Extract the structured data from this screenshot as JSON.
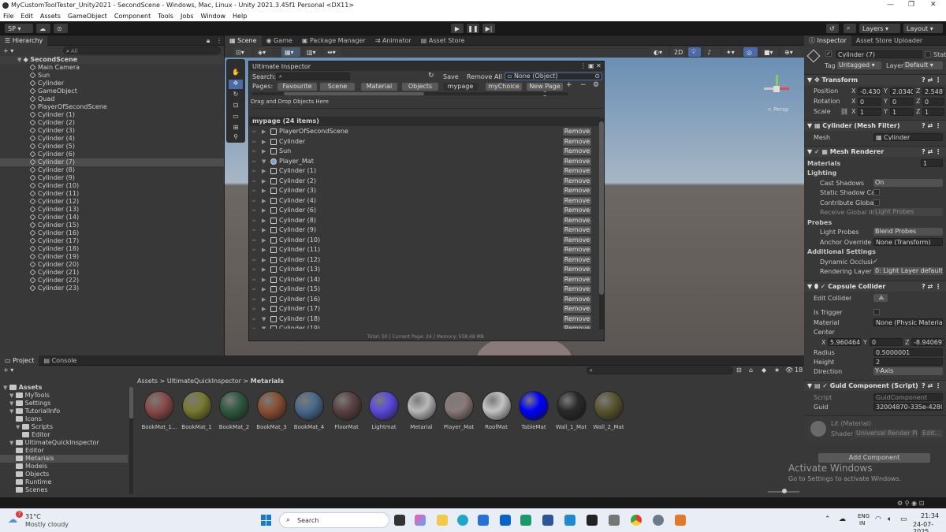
{
  "window": {
    "title": "MyCustomToolTester_Unity2021 - SecondScene - Windows, Mac, Linux - Unity 2021.3.45f1 Personal <DX11>",
    "controls": [
      "—",
      "❐",
      "✕"
    ]
  },
  "menu": [
    "File",
    "Edit",
    "Assets",
    "GameObject",
    "Component",
    "Tools",
    "Jobs",
    "Window",
    "Help"
  ],
  "toolbar": {
    "account": "SP ▾",
    "layers": "Layers",
    "layout": "Layout"
  },
  "hierarchy": {
    "tab": "Hierarchy",
    "search_placeholder": "All",
    "scene": "SecondScene",
    "items": [
      "Main Camera",
      "Sun",
      "Cylinder",
      "GameObject",
      "Quad",
      "PlayerOfSecondScene",
      "Cylinder (1)",
      "Cylinder (2)",
      "Cylinder (3)",
      "Cylinder (4)",
      "Cylinder (5)",
      "Cylinder (6)",
      "Cylinder (7)",
      "Cylinder (8)",
      "Cylinder (9)",
      "Cylinder (10)",
      "Cylinder (11)",
      "Cylinder (12)",
      "Cylinder (13)",
      "Cylinder (14)",
      "Cylinder (15)",
      "Cylinder (16)",
      "Cylinder (17)",
      "Cylinder (18)",
      "Cylinder (19)",
      "Cylinder (20)",
      "Cylinder (21)",
      "Cylinder (22)",
      "Cylinder (23)"
    ],
    "selected": "Cylinder (7)"
  },
  "center_tabs": [
    "Scene",
    "Game",
    "Package Manager",
    "Animator",
    "Asset Store"
  ],
  "scene_view": {
    "mode_2d": "2D",
    "persp": "< Persp"
  },
  "ultimate_inspector": {
    "title": "Ultimate Inspector",
    "search_label": "Search:",
    "save": "Save",
    "remove_all": "Remove All",
    "object_field": "None (Object)",
    "pages_label": "Pages:",
    "pages": [
      "Favourite",
      "Scene",
      "Material",
      "Objects",
      "mypage",
      "myChoice",
      "New Page 6"
    ],
    "active_page": "mypage",
    "drag_hint": "Drag and Drop Objects Here",
    "list_title": "mypage (24 items)",
    "remove_label": "Remove",
    "items": [
      "PlayerOfSecondScene",
      "Cylinder",
      "Sun",
      "Player_Mat",
      "Cylinder (1)",
      "Cylinder (2)",
      "Cylinder (3)",
      "Cylinder (4)",
      "Cylinder (6)",
      "Cylinder (8)",
      "Cylinder (9)",
      "Cylinder (10)",
      "Cylinder (11)",
      "Cylinder (12)",
      "Cylinder (13)",
      "Cylinder (14)",
      "Cylinder (15)",
      "Cylinder (16)",
      "Cylinder (17)",
      "Cylinder (18)",
      "Cylinder (19)"
    ],
    "footer": "Total: 50 | Current Page: 24 | Memory: 558.48 MB"
  },
  "inspector": {
    "tabs": [
      "Inspector",
      "Asset Store Uploader"
    ],
    "object_name": "Cylinder (7)",
    "static_label": "Static",
    "tag_label": "Tag",
    "tag_value": "Untagged",
    "layer_label": "Layer",
    "layer_value": "Default",
    "transform": {
      "title": "Transform",
      "position_label": "Position",
      "position": [
        "-0.430",
        "2.0340",
        "2.5487"
      ],
      "rotation_label": "Rotation",
      "rotation": [
        "0",
        "0",
        "0"
      ],
      "scale_label": "Scale",
      "scale": [
        "1",
        "1",
        "1"
      ]
    },
    "mesh_filter": {
      "title": "Cylinder (Mesh Filter)",
      "mesh_label": "Mesh",
      "mesh_value": "Cylinder"
    },
    "mesh_renderer": {
      "title": "Mesh Renderer",
      "materials_label": "Materials",
      "materials_count": "1",
      "lighting_label": "Lighting",
      "cast_shadows_label": "Cast Shadows",
      "cast_shadows": "On",
      "static_shadow_label": "Static Shadow Cas",
      "contribute_gi_label": "Contribute Global I",
      "receive_gi_label": "Receive Global Illu",
      "receive_gi": "Light Probes",
      "probes_label": "Probes",
      "light_probes_label": "Light Probes",
      "light_probes": "Blend Probes",
      "anchor_label": "Anchor Override",
      "anchor": "None (Transform)",
      "additional_label": "Additional Settings",
      "dynamic_occ_label": "Dynamic Occlusio",
      "rendering_layer_label": "Rendering Layer M",
      "rendering_layer": "0: Light Layer default"
    },
    "capsule": {
      "title": "Capsule Collider",
      "edit_label": "Edit Collider",
      "trigger_label": "Is Trigger",
      "material_label": "Material",
      "material": "None (Physic Materia",
      "center_label": "Center",
      "center": [
        "5.960464e",
        "0",
        "-8.940697"
      ],
      "radius_label": "Radius",
      "radius": "0.5000001",
      "height_label": "Height",
      "height": "2",
      "direction_label": "Direction",
      "direction": "Y-Axis"
    },
    "guid": {
      "title": "Guid Component (Script)",
      "script_label": "Script",
      "script": "GuidComponent",
      "guid_label": "Guid",
      "guid": "32004870-335e-4280-"
    },
    "material_preview": {
      "name": "Lit (Material)",
      "shader_label": "Shader",
      "shader": "Universal Render Pip",
      "edit": "Edit..."
    },
    "add_component": "Add Component"
  },
  "project": {
    "tabs": [
      "Project",
      "Console"
    ],
    "breadcrumb": [
      "Assets",
      "UltimateQuickInspector",
      "Metarials"
    ],
    "tree": [
      {
        "label": "Assets",
        "depth": 0
      },
      {
        "label": "MyTools",
        "depth": 1
      },
      {
        "label": "Settings",
        "depth": 1
      },
      {
        "label": "TutorialInfo",
        "depth": 1
      },
      {
        "label": "Icons",
        "depth": 2
      },
      {
        "label": "Scripts",
        "depth": 2
      },
      {
        "label": "Editor",
        "depth": 3
      },
      {
        "label": "UltimateQuickInspector",
        "depth": 1
      },
      {
        "label": "Editor",
        "depth": 2
      },
      {
        "label": "Metarials",
        "depth": 2
      },
      {
        "label": "Models",
        "depth": 2
      },
      {
        "label": "Objects",
        "depth": 2
      },
      {
        "label": "Runtime",
        "depth": 2
      },
      {
        "label": "Scenes",
        "depth": 2
      }
    ],
    "badge_count": "18",
    "materials": [
      {
        "name": "BookMat_1...",
        "color": "#8a4a4a"
      },
      {
        "name": "BookMat_1",
        "color": "#7a7a30"
      },
      {
        "name": "BookMat_2",
        "color": "#2f5a3f"
      },
      {
        "name": "BookMat_3",
        "color": "#8a4f33"
      },
      {
        "name": "BookMat_4",
        "color": "#4a6a8c"
      },
      {
        "name": "FloorMat",
        "color": "#5a4242"
      },
      {
        "name": "Lightmat",
        "color": "#5a4ae0"
      },
      {
        "name": "Metarial",
        "color": "#b9b9b9"
      },
      {
        "name": "Player_Mat",
        "color": "#8c7a7a"
      },
      {
        "name": "RoofMat",
        "color": "#c4c4c4"
      },
      {
        "name": "TableMat",
        "color": "#0000ff"
      },
      {
        "name": "Wall_1_Mat",
        "color": "#2a2a2a"
      },
      {
        "name": "Wall_2_Mat",
        "color": "#5a5530"
      }
    ]
  },
  "activate": {
    "line1": "Activate Windows",
    "line2": "Go to Settings to activate Windows."
  },
  "taskbar": {
    "weather_temp": "31°C",
    "weather_text": "Mostly cloudy",
    "weather_badge": "7",
    "search": "Search",
    "lang1": "ENG",
    "lang2": "IN",
    "time": "21:34",
    "date": "24-07-2025"
  }
}
